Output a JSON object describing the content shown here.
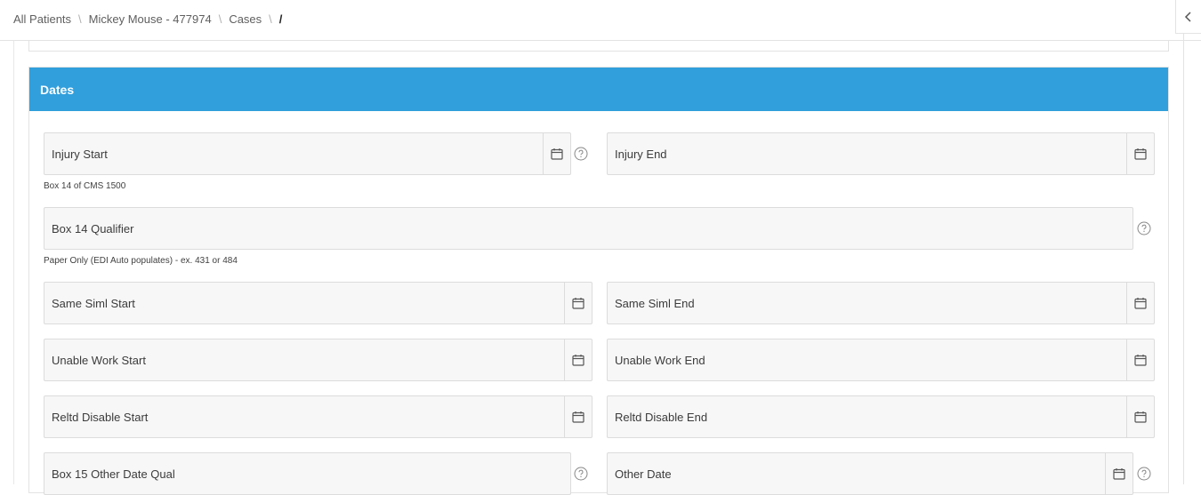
{
  "breadcrumb": {
    "items": [
      "All Patients",
      "Mickey Mouse - 477974",
      "Cases"
    ],
    "separator": "\\",
    "current": "/"
  },
  "panel": {
    "title": "Dates"
  },
  "fields": {
    "injury_start": {
      "label": "Injury Start",
      "hint": "Box 14 of CMS 1500"
    },
    "injury_end": {
      "label": "Injury End"
    },
    "box14_qualifier": {
      "label": "Box 14 Qualifier",
      "hint": "Paper Only (EDI Auto populates) - ex. 431 or 484"
    },
    "same_siml_start": {
      "label": "Same Siml Start"
    },
    "same_siml_end": {
      "label": "Same Siml End"
    },
    "unable_work_start": {
      "label": "Unable Work Start"
    },
    "unable_work_end": {
      "label": "Unable Work End"
    },
    "reltd_disable_start": {
      "label": "Reltd Disable Start"
    },
    "reltd_disable_end": {
      "label": "Reltd Disable End"
    },
    "box15_other_date_qual": {
      "label": "Box 15 Other Date Qual"
    },
    "other_date": {
      "label": "Other Date"
    }
  },
  "colors": {
    "header_blue": "#319fdc",
    "field_bg": "#f7f7f7",
    "border": "#dcdcdc"
  },
  "icons": {
    "calendar": "calendar-icon",
    "help": "help-circle-icon",
    "collapse": "chevron-left-icon"
  }
}
